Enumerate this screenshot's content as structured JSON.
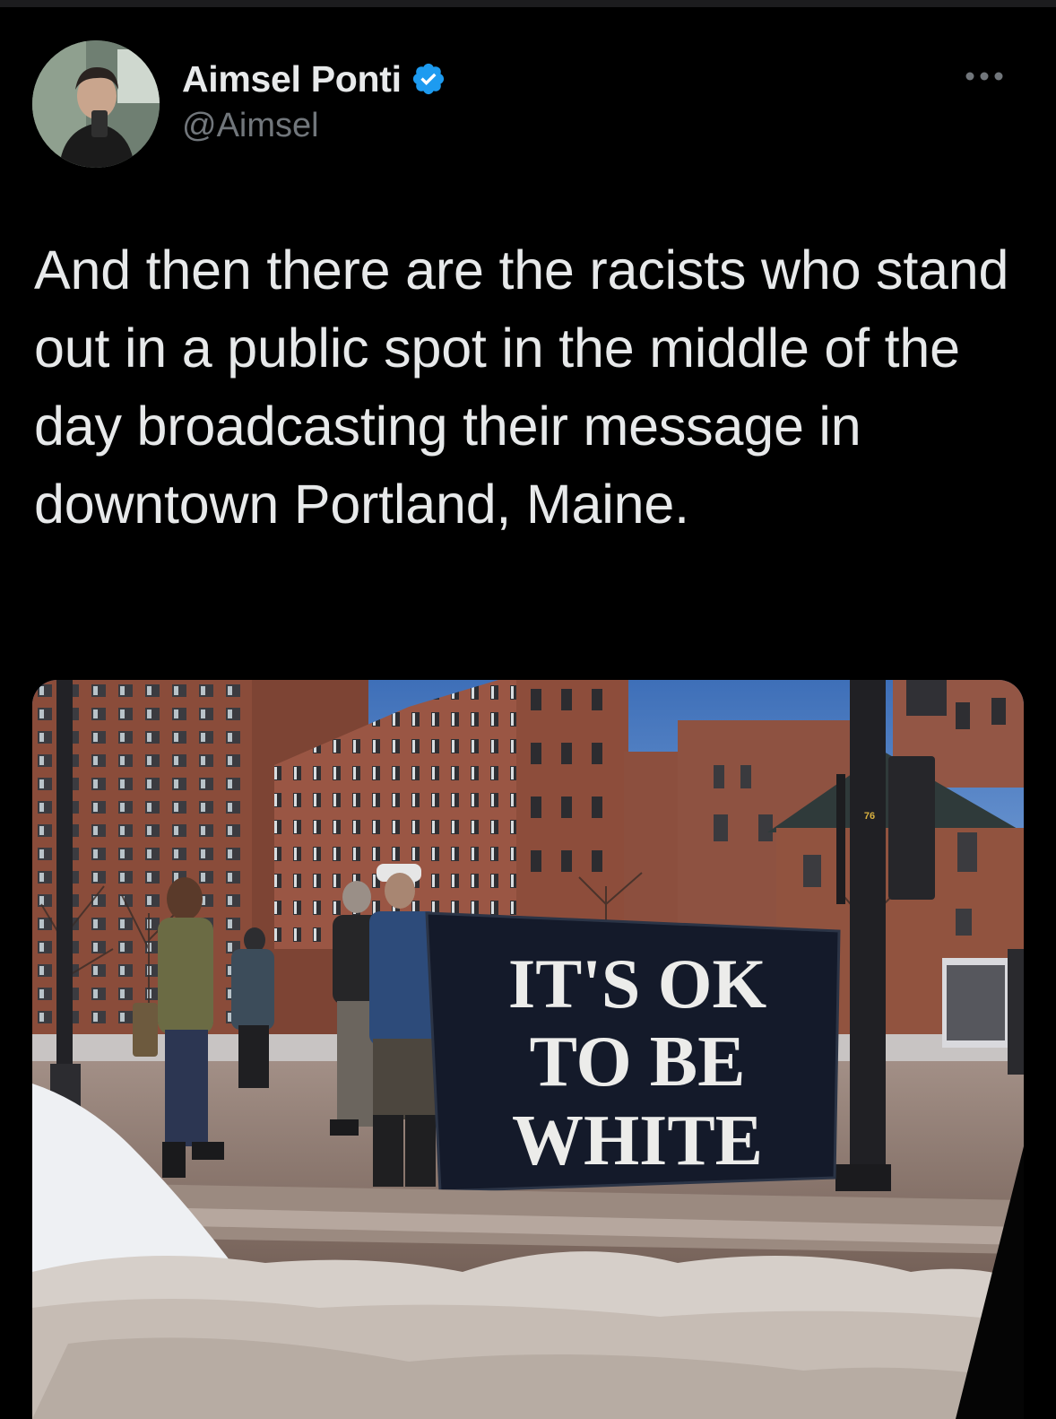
{
  "tweet": {
    "author": {
      "display_name": "Aimsel Ponti",
      "handle": "@Aimsel",
      "verified": true,
      "avatar_icon": "avatar-photo"
    },
    "more_icon": "more-options-icon",
    "text": "And then there are the racists who stand out in a public spot in the middle of the day broadcasting their message in downtown Portland, Maine.",
    "media": {
      "banner_lines": [
        "IT'S OK",
        "TO BE",
        "WHITE"
      ],
      "pole_sign": "76"
    }
  },
  "colors": {
    "background": "#000000",
    "text_primary": "#e7e9ea",
    "text_secondary": "#71767b",
    "verified_blue": "#1d9bf0"
  }
}
